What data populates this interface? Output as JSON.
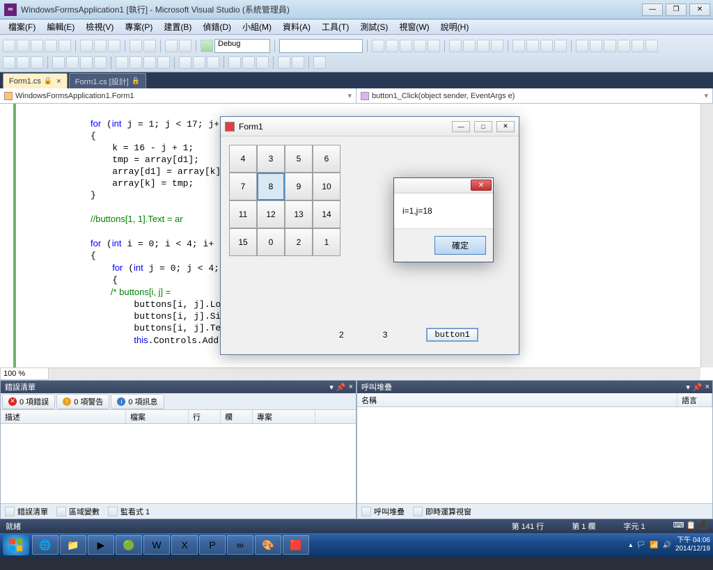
{
  "title": "WindowsFormsApplication1 [執行] - Microsoft Visual Studio (系統管理員)",
  "menu": [
    "檔案(F)",
    "編輯(E)",
    "檢視(V)",
    "專案(P)",
    "建置(B)",
    "偵錯(D)",
    "小組(M)",
    "資料(A)",
    "工具(T)",
    "測試(S)",
    "視窗(W)",
    "說明(H)"
  ],
  "config": "Debug",
  "tabs": {
    "active": "Form1.cs",
    "inactive": "Form1.cs [設計]"
  },
  "dropdowns": {
    "left": "WindowsFormsApplication1.Form1",
    "right": "button1_Click(object sender, EventArgs e)"
  },
  "code_lines": [
    {
      "t": "for (int j = 1; j < 17; j+",
      "kw": [
        "for",
        "int"
      ]
    },
    {
      "t": "{"
    },
    {
      "t": "    k = 16 - j + 1;"
    },
    {
      "t": "    tmp = array[d1];"
    },
    {
      "t": "    array[d1] = array[k];"
    },
    {
      "t": "    array[k] = tmp;"
    },
    {
      "t": "}"
    },
    {
      "t": ""
    },
    {
      "t": "//buttons[1, 1].Text = ar",
      "cm": true
    },
    {
      "t": ""
    },
    {
      "t": "for (int i = 0; i < 4; i+",
      "kw": [
        "for",
        "int"
      ]
    },
    {
      "t": "{"
    },
    {
      "t": "    for (int j = 0; j < 4;",
      "kw": [
        "for",
        "int"
      ]
    },
    {
      "t": "    {"
    },
    {
      "t": "        /* buttons[i, j] =",
      "cm": true
    },
    {
      "t": "        buttons[i, j].Loca"
    },
    {
      "t": "        buttons[i, j].Size"
    },
    {
      "t": "        buttons[i, j].Text"
    },
    {
      "t": "        this.Controls.Add(",
      "kw": [
        "this"
      ]
    }
  ],
  "zoom": "100 %",
  "errlist": {
    "title": "錯誤清單",
    "pills": {
      "err": "0 項錯誤",
      "warn": "0 項警告",
      "info": "0 項訊息"
    },
    "cols": [
      "描述",
      "檔案",
      "行",
      "欄",
      "專案"
    ],
    "foot": [
      "錯誤清單",
      "區域變數",
      "監看式 1"
    ]
  },
  "callstack": {
    "title": "呼叫堆疊",
    "cols": [
      "名稱",
      "語言"
    ],
    "foot": [
      "呼叫堆疊",
      "即時運算視窗"
    ]
  },
  "status": {
    "ready": "就緒",
    "line": "第 141 行",
    "col": "第 1 欄",
    "ch": "字元 1"
  },
  "form1": {
    "title": "Form1",
    "grid": [
      "4",
      "3",
      "5",
      "6",
      "7",
      "8",
      "9",
      "10",
      "11",
      "12",
      "13",
      "14",
      "15",
      "0",
      "2",
      "1"
    ],
    "selected_index": 5,
    "bottom": {
      "n2": "2",
      "n3": "3",
      "btn": "button1"
    }
  },
  "msgbox": {
    "text": "i=1,j=18",
    "ok": "確定"
  },
  "tray": {
    "time": "下午 04:06",
    "date": "2014/12/19"
  },
  "taskbar_apps": [
    "🌐",
    "📁",
    "▶",
    "🟢",
    "W",
    "X",
    "P",
    "∞",
    "🎨",
    "🟥"
  ]
}
